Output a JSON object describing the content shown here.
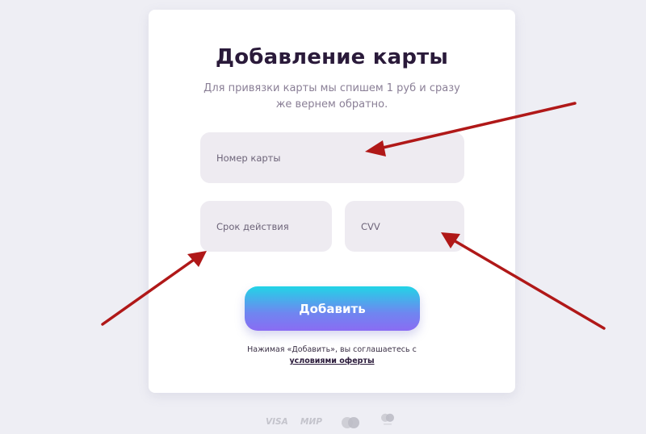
{
  "form": {
    "title": "Добавление карты",
    "subtitle": "Для привязки карты мы спишем 1 руб и сразу же вернем обратно.",
    "card_number_placeholder": "Номер карты",
    "expiry_placeholder": "Срок действия",
    "cvv_placeholder": "CVV",
    "submit_label": "Добавить",
    "agreement_text": "Нажимая «Добавить», вы соглашаетесь с",
    "agreement_link": "условиями оферты"
  },
  "payment_logos": {
    "visa": "VISA",
    "mir": "МИР"
  },
  "colors": {
    "annotation_arrow": "#b01818",
    "button_gradient_top": "#22d4e6",
    "button_gradient_bottom": "#8a6cf3"
  },
  "icons": [
    "visa-logo",
    "mir-logo",
    "mastercard-icon",
    "maestro-icon"
  ]
}
